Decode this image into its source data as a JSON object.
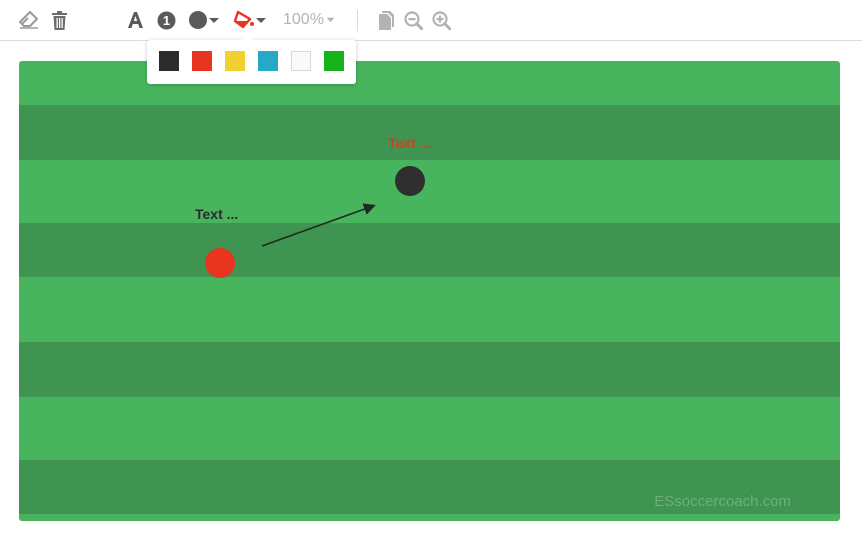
{
  "toolbar": {
    "tools": [
      {
        "name": "eraser-icon"
      },
      {
        "name": "trash-icon"
      },
      {
        "name": "text-tool-icon"
      },
      {
        "name": "number-marker-icon",
        "glyph": "1"
      },
      {
        "name": "player-shape-icon"
      },
      {
        "name": "fill-color-icon",
        "color": "#e8351f"
      }
    ],
    "zoom_label": "100%",
    "right_tools": [
      {
        "name": "copy-icon"
      },
      {
        "name": "zoom-out-icon"
      },
      {
        "name": "zoom-in-icon"
      }
    ]
  },
  "palette": {
    "colors": [
      "#2b2b2b",
      "#e8351f",
      "#f0d131",
      "#27a9c6",
      "#fafafa",
      "#15b21a"
    ]
  },
  "field": {
    "stripe_light": "#48b55e",
    "stripe_dark": "#3e9450",
    "labels": [
      {
        "text": "Text ...",
        "color": "#2a2a2a"
      },
      {
        "text": "Text ...",
        "color": "#e8351f"
      }
    ],
    "players": [
      {
        "color": "#e8351f"
      },
      {
        "color": "#2f2f2f"
      }
    ],
    "watermark": "ESsoccercoach.com"
  }
}
